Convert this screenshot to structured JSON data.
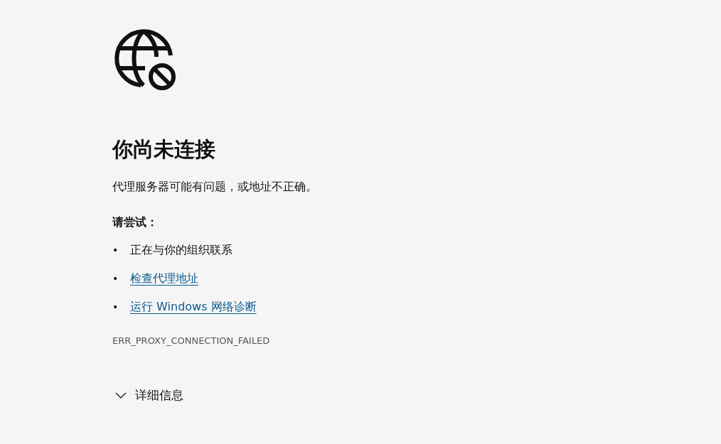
{
  "title": "你尚未连接",
  "message": "代理服务器可能有问题，或地址不正确。",
  "suggestions_heading": "请尝试：",
  "suggestions": [
    {
      "kind": "text",
      "bullet": "•",
      "label": "正在与你的组织联系"
    },
    {
      "kind": "link",
      "bullet": "•",
      "label": "检查代理地址"
    },
    {
      "kind": "link",
      "bullet": "•",
      "label": "运行 Windows 网络诊断"
    }
  ],
  "error_code": "ERR_PROXY_CONNECTION_FAILED",
  "details": {
    "label": "详细信息",
    "expanded": false
  }
}
